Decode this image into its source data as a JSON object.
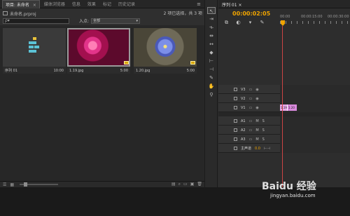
{
  "project_panel": {
    "tabs": [
      {
        "label": "项目: 未命名",
        "active": true
      },
      {
        "label": "媒体浏览器",
        "active": false
      },
      {
        "label": "信息",
        "active": false
      },
      {
        "label": "效果",
        "active": false
      },
      {
        "label": "标记",
        "active": false
      },
      {
        "label": "历史记录",
        "active": false
      }
    ],
    "tab_close": "×",
    "project_file": "未命名.prproj",
    "selection_status": "2 项已选择，共 3 项",
    "search_glyph": "ρ▾",
    "inpoint_label": "入点:",
    "inpoint_value": "全部",
    "items": [
      {
        "name": "序列 01",
        "duration": "10:00",
        "kind": "sequence"
      },
      {
        "name": "1.19.jpg",
        "duration": "5:00",
        "kind": "image"
      },
      {
        "name": "1.20.jpg",
        "duration": "5:00",
        "kind": "image"
      }
    ]
  },
  "timeline": {
    "tab_label": "序列 01 ×",
    "timecode": "00:00:02:05",
    "ruler_labels": [
      "00:00",
      "00:00:15:00",
      "00:00:30:00"
    ],
    "tracks": [
      {
        "name": "V3",
        "type": "video"
      },
      {
        "name": "V2",
        "type": "video"
      },
      {
        "name": "V1",
        "type": "video",
        "clips": [
          "1.19",
          "1.20"
        ]
      },
      {
        "name": "A1",
        "type": "audio",
        "flags": [
          "M",
          "S"
        ]
      },
      {
        "name": "A2",
        "type": "audio",
        "flags": [
          "M",
          "S"
        ]
      },
      {
        "name": "A3",
        "type": "audio",
        "flags": [
          "M",
          "S"
        ]
      },
      {
        "name": "主声道",
        "type": "master",
        "value": "0.0"
      }
    ]
  },
  "tools": [
    "selection",
    "track-select",
    "ripple",
    "rolling",
    "rate-stretch",
    "razor",
    "slip",
    "slide",
    "pen",
    "hand",
    "zoom"
  ],
  "watermark": {
    "brand": "Baidu 经验",
    "url": "jingyan.baidu.com"
  },
  "colors": {
    "timecode": "#f0a400",
    "playhead": "#c44444",
    "clip": "#e8a7e8"
  }
}
